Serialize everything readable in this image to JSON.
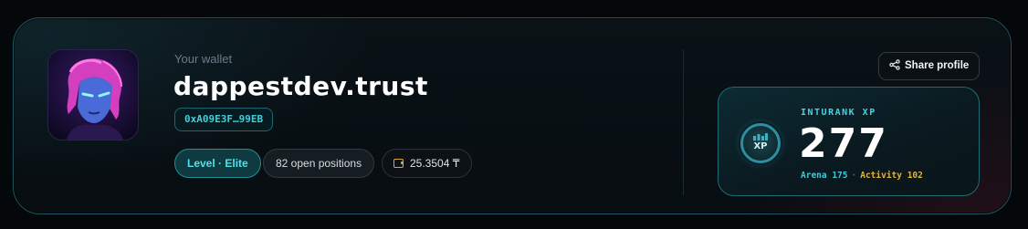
{
  "profile": {
    "wallet_label": "Your wallet",
    "name": "dappestdev.trust",
    "address": "0xA09E3F…99EB",
    "level": "Level · Elite",
    "open_positions": "82 open positions",
    "balance": "25.3504 ₸"
  },
  "actions": {
    "share_label": "Share profile"
  },
  "xp": {
    "title": "INTURANK XP",
    "badge_label": "XP",
    "value": "277",
    "arena": "Arena 175",
    "separator": "·",
    "activity": "Activity 102"
  },
  "colors": {
    "accent_cyan": "#47d3e0",
    "accent_gold": "#e0b43d",
    "avatar_magenta": "#e040c8"
  },
  "icons": {
    "share": "share-icon",
    "wallet": "wallet-icon",
    "xp": "xp-badge-icon"
  }
}
